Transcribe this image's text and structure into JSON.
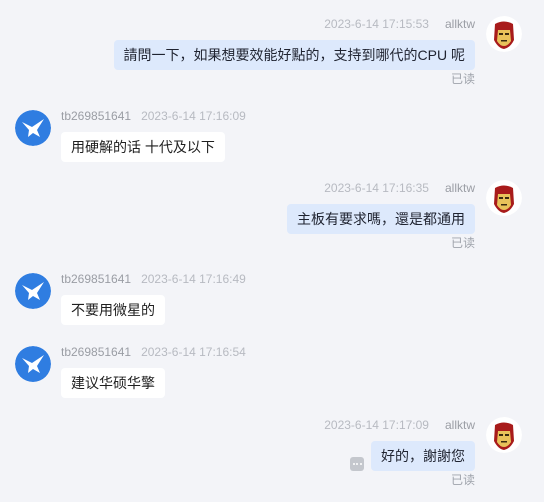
{
  "chat": {
    "messages": [
      {
        "direction": "out",
        "sender": "allktw",
        "timestamp": "2023-6-14 17:15:53",
        "text": "請問一下，如果想要效能好點的，支持到哪代的CPU 呢",
        "status": "已读",
        "avatar": "iron-man-avatar-icon"
      },
      {
        "direction": "in",
        "sender": "tb269851641",
        "timestamp": "2023-6-14 17:16:09",
        "text": "用硬解的话 十代及以下",
        "avatar": "blue-bird-avatar-icon"
      },
      {
        "direction": "out",
        "sender": "allktw",
        "timestamp": "2023-6-14 17:16:35",
        "text": "主板有要求嗎，還是都通用",
        "status": "已读",
        "avatar": "iron-man-avatar-icon"
      },
      {
        "direction": "in",
        "sender": "tb269851641",
        "timestamp": "2023-6-14 17:16:49",
        "text": "不要用微星的",
        "avatar": "blue-bird-avatar-icon"
      },
      {
        "direction": "in",
        "sender": "tb269851641",
        "timestamp": "2023-6-14 17:16:54",
        "text": "建议华硕华擎",
        "avatar": "blue-bird-avatar-icon"
      },
      {
        "direction": "out",
        "sender": "allktw",
        "timestamp": "2023-6-14 17:17:09",
        "text": "好的，謝謝您",
        "status": "已读",
        "avatar": "iron-man-avatar-icon",
        "action_icon": "more-options-icon"
      }
    ]
  },
  "colors": {
    "background": "#f3f4f8",
    "outgoing_bubble": "#dde9fc",
    "incoming_bubble": "#ffffff",
    "bird_avatar": "#2f7de1",
    "ironman_red": "#a81b1b",
    "ironman_gold": "#e8c25a"
  }
}
